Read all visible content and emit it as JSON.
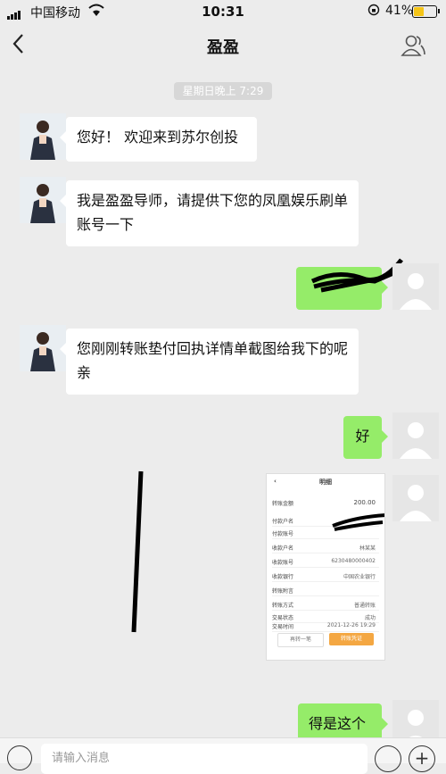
{
  "status_bar": {
    "carrier": "中国移动",
    "time": "10:31",
    "battery": "41%",
    "battery_level": 0.41
  },
  "nav": {
    "title": "盈盈",
    "back_icon": "chevron-left-icon",
    "people_icon": "person-icon"
  },
  "timestamp": "星期日晚上 7:29",
  "messages": [
    {
      "side": "left",
      "text": "您好！ 欢迎来到苏尔创投"
    },
    {
      "side": "left",
      "text": "我是盈盈导师，请提供下您的凤凰娱乐刷单账号一下"
    },
    {
      "side": "right",
      "text": ""
    },
    {
      "side": "left",
      "text": "您刚刚转账垫付回执详情单截图给我下的呢 亲"
    },
    {
      "side": "right",
      "text": "好"
    },
    {
      "side": "right",
      "text": "得是这个"
    }
  ],
  "screenshot": {
    "title": "明细",
    "amount_label": "转账金额",
    "amount": "200.00",
    "rows": [
      {
        "k": "付款户名",
        "v": ""
      },
      {
        "k": "付款账号",
        "v": ""
      },
      {
        "k": "收款户名",
        "v": "林某某"
      },
      {
        "k": "收款账号",
        "v": "6230480000402"
      },
      {
        "k": "收款银行",
        "v": "中国农业银行"
      },
      {
        "k": "转账附言",
        "v": ""
      },
      {
        "k": "转账方式",
        "v": "普通转账"
      },
      {
        "k": "交易状态",
        "v": "成功"
      },
      {
        "k": "交易时间",
        "v": "2021-12-26 19:29"
      }
    ],
    "btn_left": "再转一笔",
    "btn_right": "转账凭证"
  },
  "input": {
    "placeholder": "请输入消息"
  },
  "colors": {
    "background": "#ececec",
    "bubble_self": "#95ec69",
    "bubble_other": "#ffffff"
  }
}
